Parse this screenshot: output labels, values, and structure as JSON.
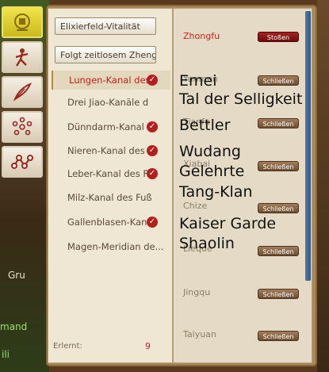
{
  "tabs": [
    {
      "name": "tab-sect",
      "icon": "sect-emblem-icon",
      "active": true
    },
    {
      "name": "tab-martial",
      "icon": "martial-artist-icon",
      "active": false
    },
    {
      "name": "tab-skills",
      "icon": "feather-hand-icon",
      "active": false
    },
    {
      "name": "tab-acupoints",
      "icon": "acupoint-network-icon",
      "active": false
    },
    {
      "name": "tab-meridians",
      "icon": "meridian-nodes-icon",
      "active": false
    }
  ],
  "left_panel": {
    "elixir_button": "Elixierfeld-Vitalität",
    "follow_button": "Folgt zeitlosem Zheng",
    "meridians": [
      {
        "label": "Lungen-Kanal des",
        "checked": true,
        "active": true
      },
      {
        "label": "Drei Jiao-Kanäle d",
        "checked": false,
        "active": false
      },
      {
        "label": "Dünndarm-Kanal",
        "checked": true,
        "active": false
      },
      {
        "label": "Nieren-Kanal des",
        "checked": true,
        "active": false
      },
      {
        "label": "Leber-Kanal des F",
        "checked": true,
        "active": false
      },
      {
        "label": "Milz-Kanal des Fuß",
        "checked": false,
        "active": false
      },
      {
        "label": "Gallenblasen-Kan",
        "checked": true,
        "active": false
      },
      {
        "label": "Magen-Meridian de...",
        "checked": false,
        "active": false
      }
    ],
    "learned_label": "Erlernt:",
    "learned_count": "9"
  },
  "right_panel": {
    "items": [
      {
        "label": "Zhongfu",
        "button": "Stoßen",
        "active": true
      },
      {
        "label": "Yunmen",
        "button": "Schließen",
        "active": false
      },
      {
        "label": "Tianfu",
        "button": "Schließen",
        "active": false
      },
      {
        "label": "Xiabai",
        "button": "Schließen",
        "active": false
      },
      {
        "label": "Chize",
        "button": "Schließen",
        "active": false
      },
      {
        "label": "Lieque",
        "button": "Schließen",
        "active": false
      },
      {
        "label": "Jingqu",
        "button": "Schließen",
        "active": false
      },
      {
        "label": "Taiyuan",
        "button": "Schließen",
        "active": false
      }
    ]
  },
  "overlay_labels": [
    "Emei",
    "Tal der Selligkeit",
    "Bettler",
    "Wudang",
    "Gelehrte",
    "Tang-Klan",
    "Kaiser Garde",
    "Shaolin"
  ],
  "side_texts": [
    "Gru",
    "",
    "mand",
    "ili"
  ],
  "colors": {
    "accent_red": "#c02020",
    "tab_active": "#e6d83a"
  }
}
